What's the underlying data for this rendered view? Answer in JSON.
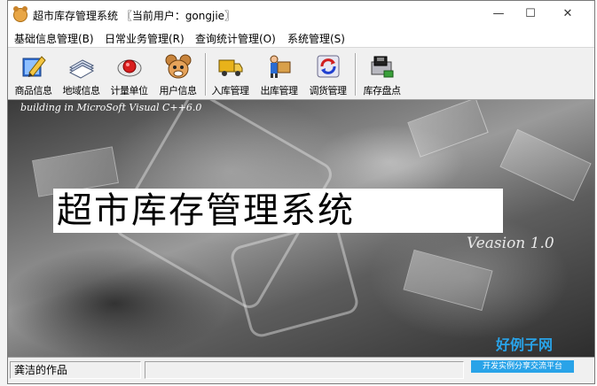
{
  "window": {
    "title": "超市库存管理系统 〖当前用户：gongjie〗",
    "controls": {
      "minimize": "—",
      "maximize": "☐",
      "close": "✕"
    }
  },
  "menu": [
    {
      "label": "基础信息管理(B)"
    },
    {
      "label": "日常业务管理(R)"
    },
    {
      "label": "查询统计管理(O)"
    },
    {
      "label": "系统管理(S)"
    }
  ],
  "toolbar": {
    "goods_info": {
      "label": "商品信息",
      "icon": "pencil-book-icon"
    },
    "region_info": {
      "label": "地域信息",
      "icon": "paper-stack-icon"
    },
    "unit": {
      "label": "计量单位",
      "icon": "red-disc-icon"
    },
    "user_info": {
      "label": "用户信息",
      "icon": "mouse-face-icon"
    },
    "stock_in": {
      "label": "入库管理",
      "icon": "truck-icon"
    },
    "stock_out": {
      "label": "出库管理",
      "icon": "delivery-man-icon"
    },
    "transfer": {
      "label": "调货管理",
      "icon": "refresh-icon"
    },
    "inventory": {
      "label": "库存盘点",
      "icon": "disk-drive-icon"
    }
  },
  "splash": {
    "note": "building in MicroSoft Visual C++6.0",
    "title": "超市库存管理系统",
    "version": "Veasion 1.0"
  },
  "watermark": {
    "site_name": "好例子网",
    "tagline": "开发实例分享交流平台"
  },
  "status": {
    "author": "龚洁的作品"
  },
  "colors": {
    "watermark_blue": "#29a3e8"
  }
}
